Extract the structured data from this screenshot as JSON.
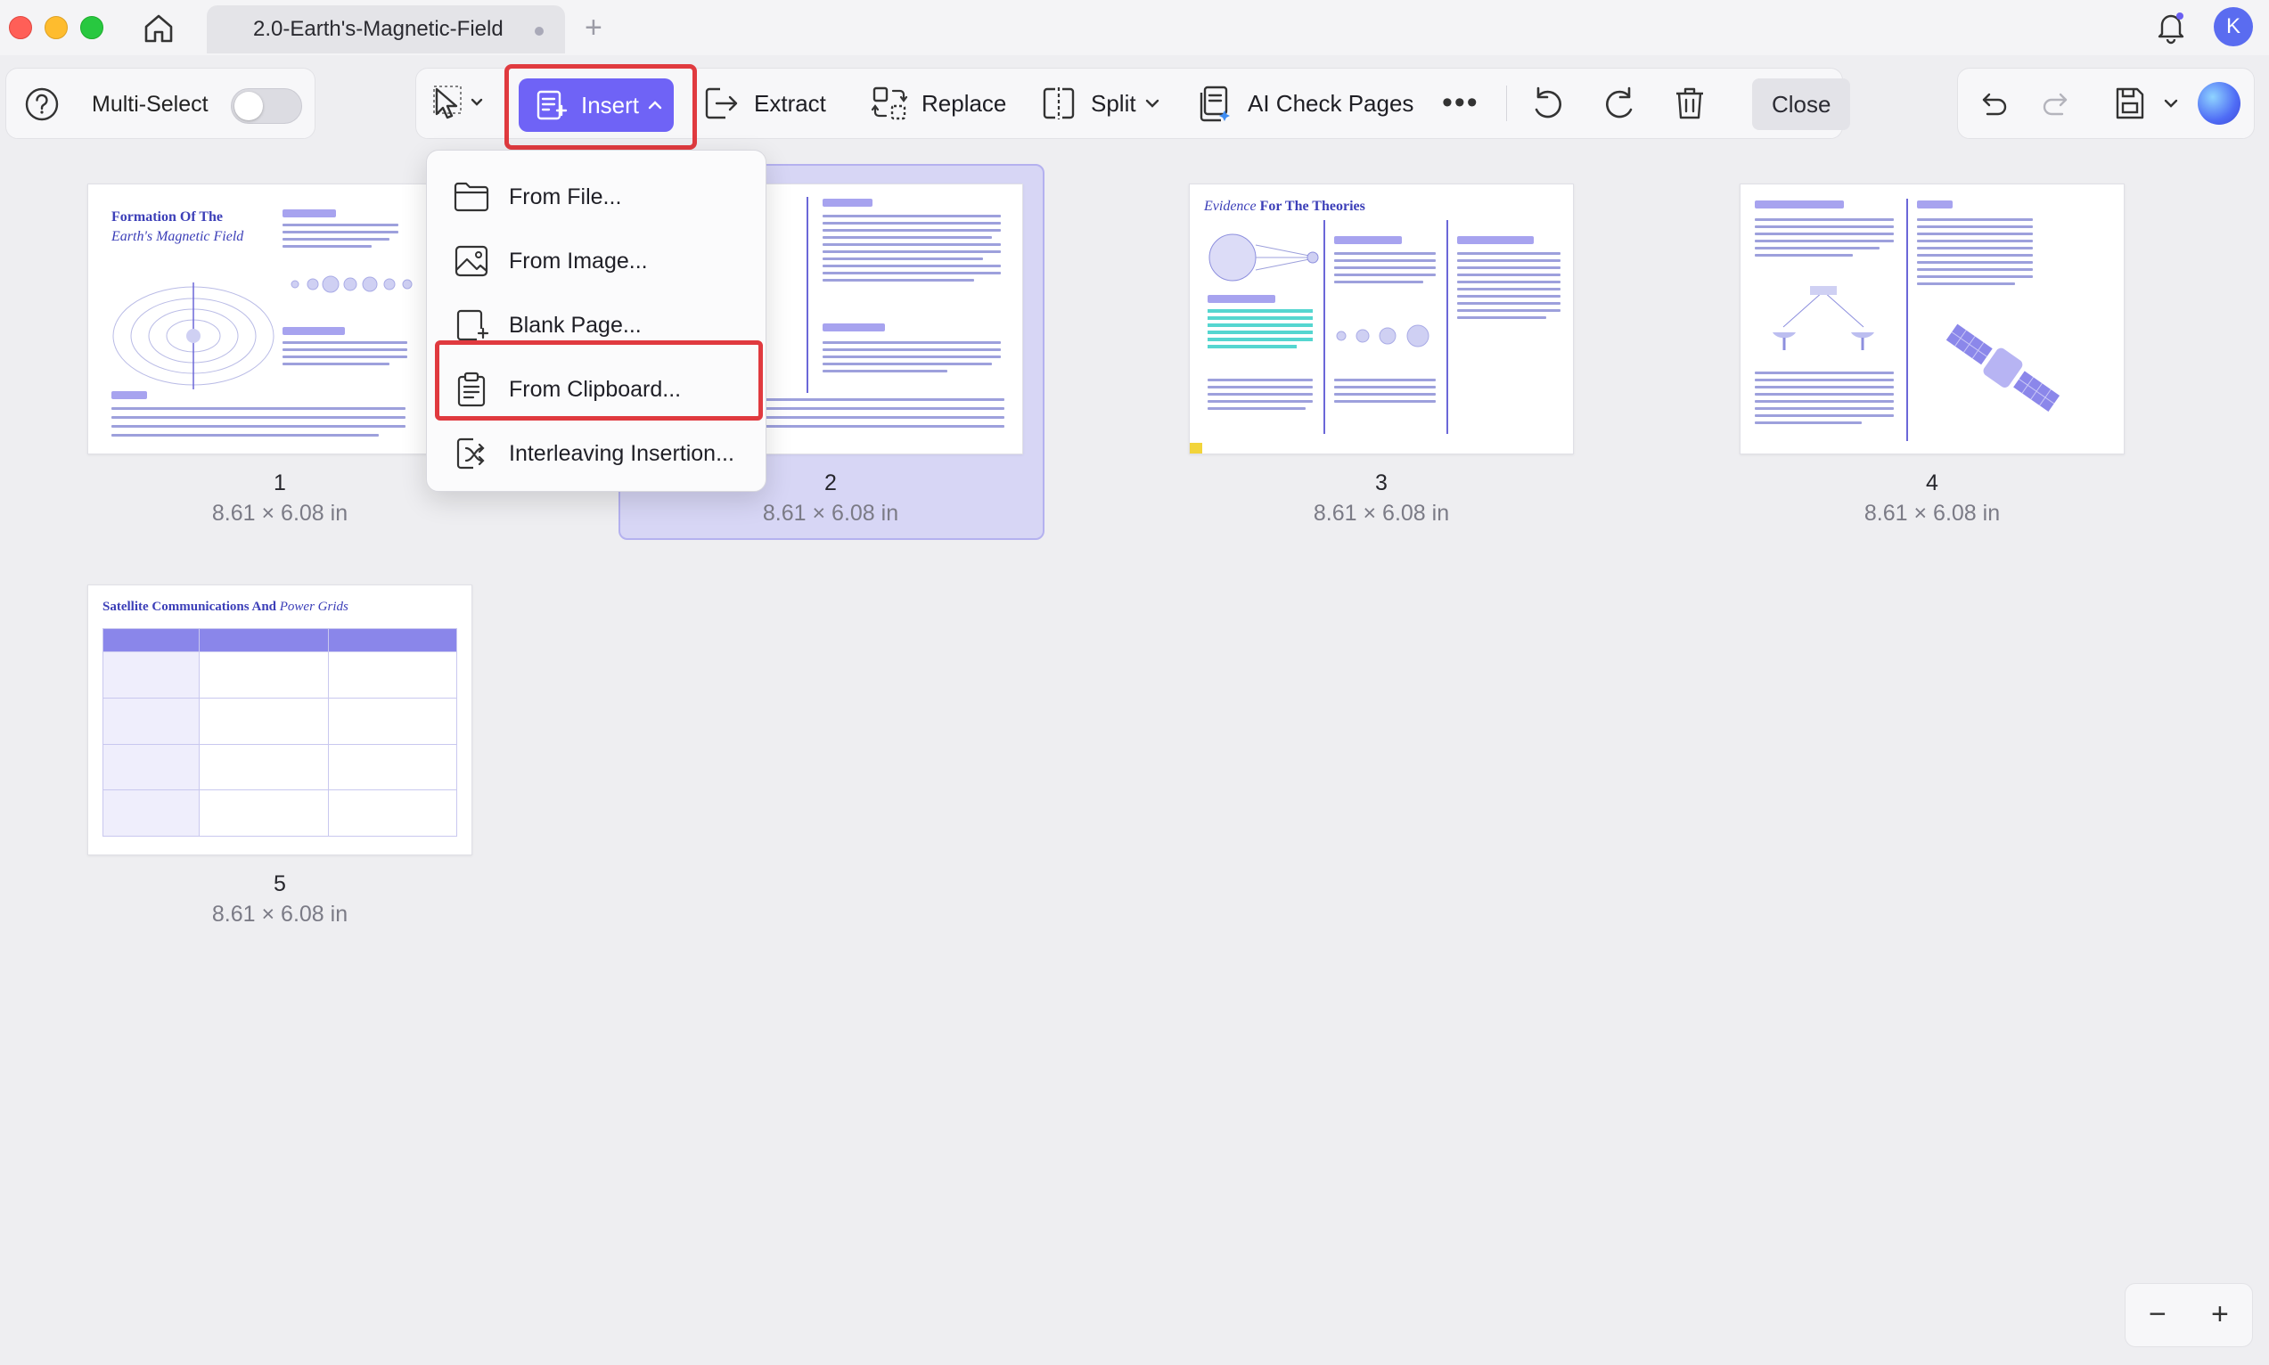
{
  "window": {
    "tab_title": "2.0-Earth's-Magnetic-Field",
    "new_tab_label": "+",
    "avatar_initial": "K"
  },
  "toolbar": {
    "multi_select_label": "Multi-Select",
    "multi_select_on": false,
    "insert_label": "Insert",
    "extract_label": "Extract",
    "replace_label": "Replace",
    "split_label": "Split",
    "ai_check_label": "AI Check Pages",
    "more_label": "•••",
    "close_label": "Close",
    "accent_color": "#6f63f6",
    "highlight_color": "#e03a3f"
  },
  "insert_menu": {
    "items": [
      {
        "label": "From File...",
        "icon": "folder-icon"
      },
      {
        "label": "From Image...",
        "icon": "image-icon"
      },
      {
        "label": "Blank Page...",
        "icon": "blank-page-icon"
      },
      {
        "label": "From Clipboard...",
        "icon": "clipboard-icon",
        "highlighted": true
      },
      {
        "label": "Interleaving Insertion...",
        "icon": "interleave-icon"
      }
    ]
  },
  "pages": [
    {
      "number": "1",
      "size": "8.61 × 6.08 in",
      "title_a": "Formation Of The",
      "title_b": "Earth's Magnetic Field"
    },
    {
      "number": "2",
      "size": "8.61 × 6.08 in",
      "selected": true
    },
    {
      "number": "3",
      "size": "8.61 × 6.08 in",
      "title_a": "Evidence",
      "title_b": "For The Theories"
    },
    {
      "number": "4",
      "size": "8.61 × 6.08 in"
    },
    {
      "number": "5",
      "size": "8.61 × 6.08 in",
      "title_a": "Satellite Communications And",
      "title_b": "Power Grids"
    }
  ],
  "zoom": {
    "out_label": "−",
    "in_label": "+"
  }
}
